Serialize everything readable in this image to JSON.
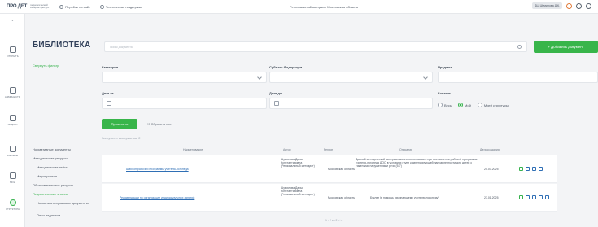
{
  "topbar": {
    "logo": "ПРО ДЕТ",
    "logo_sub": "педагогический интернет-ресурс",
    "link1": "Перейти на сайт",
    "link2": "Техническая поддержка",
    "center": "Региональный методист  Московская область",
    "user_badge": "ДШ  Шумилова Д.К."
  },
  "sidebar": {
    "items": [
      {
        "label": ""
      },
      {
        "label": "ОТКРЫТЬ"
      },
      {
        "label": "АДМИНИСТР."
      },
      {
        "label": "ЗАДАЧИ"
      },
      {
        "label": "Контакты"
      },
      {
        "label": "МОИ"
      },
      {
        "label": "СТРУКТУРА"
      }
    ]
  },
  "header": {
    "title": "БИБЛИОТЕКА",
    "search_placeholder": "Поиск документа",
    "add_button": "+ Добавить документ"
  },
  "filters": {
    "collapse_label": "Свернуть фильтр",
    "category_label": "Категория",
    "subject_label": "Субъект Федерации",
    "predmet_label": "Предмет",
    "date_from_label": "Дата от",
    "date_to_label": "Дата до",
    "content_label": "Контент",
    "radios": [
      "Весь",
      "Мой",
      "Моей структуры"
    ],
    "apply_button": "Применить",
    "reset_label": "Сбросить все",
    "loaded_label": "Загружено материалов: 2"
  },
  "categories": [
    {
      "label": "Нормативные документы"
    },
    {
      "label": "Методические ресурсы"
    },
    {
      "label": "Методические кейсы"
    },
    {
      "label": "Мероприятия"
    },
    {
      "label": "Образовательные ресурсы"
    },
    {
      "label": "Педагогические классы"
    },
    {
      "label": "Нормативно-правовые документы"
    },
    {
      "label": "Опыт педагогов"
    }
  ],
  "table": {
    "headers": [
      "Наименование",
      "Автор",
      "Регион",
      "Описание",
      "Дата создания"
    ],
    "rows": [
      {
        "name": "Шаблон рабочей программы учителя-логопеда",
        "author": "Шумилова Дарья Константиновна (Региональный методист)",
        "region": "Московская область",
        "description": "Данный методический материал можно использовать при составлении рабочей программы учителя-логопеда ДОО в условиях групп компенсирующей направленности для детей с тяжелыми нарушениями речи (5-7)",
        "date": "20.03.2025"
      },
      {
        "name": "Рекомендации по организации индивидуальных занятий",
        "author": "Шумилова Дарья Константиновна (Региональный методист)",
        "region": "Московская область",
        "description": "Буклет (в помощь начинающему учителю-логопеду)",
        "date": "23.01.2025"
      }
    ]
  },
  "pager": {
    "text": "1 - 2 из 2"
  }
}
